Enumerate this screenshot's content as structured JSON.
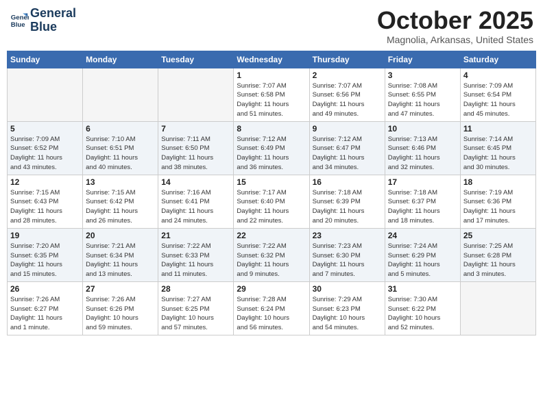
{
  "header": {
    "logo_line1": "General",
    "logo_line2": "Blue",
    "month": "October 2025",
    "location": "Magnolia, Arkansas, United States"
  },
  "weekdays": [
    "Sunday",
    "Monday",
    "Tuesday",
    "Wednesday",
    "Thursday",
    "Friday",
    "Saturday"
  ],
  "weeks": [
    [
      {
        "day": "",
        "info": ""
      },
      {
        "day": "",
        "info": ""
      },
      {
        "day": "",
        "info": ""
      },
      {
        "day": "1",
        "info": "Sunrise: 7:07 AM\nSunset: 6:58 PM\nDaylight: 11 hours\nand 51 minutes."
      },
      {
        "day": "2",
        "info": "Sunrise: 7:07 AM\nSunset: 6:56 PM\nDaylight: 11 hours\nand 49 minutes."
      },
      {
        "day": "3",
        "info": "Sunrise: 7:08 AM\nSunset: 6:55 PM\nDaylight: 11 hours\nand 47 minutes."
      },
      {
        "day": "4",
        "info": "Sunrise: 7:09 AM\nSunset: 6:54 PM\nDaylight: 11 hours\nand 45 minutes."
      }
    ],
    [
      {
        "day": "5",
        "info": "Sunrise: 7:09 AM\nSunset: 6:52 PM\nDaylight: 11 hours\nand 43 minutes."
      },
      {
        "day": "6",
        "info": "Sunrise: 7:10 AM\nSunset: 6:51 PM\nDaylight: 11 hours\nand 40 minutes."
      },
      {
        "day": "7",
        "info": "Sunrise: 7:11 AM\nSunset: 6:50 PM\nDaylight: 11 hours\nand 38 minutes."
      },
      {
        "day": "8",
        "info": "Sunrise: 7:12 AM\nSunset: 6:49 PM\nDaylight: 11 hours\nand 36 minutes."
      },
      {
        "day": "9",
        "info": "Sunrise: 7:12 AM\nSunset: 6:47 PM\nDaylight: 11 hours\nand 34 minutes."
      },
      {
        "day": "10",
        "info": "Sunrise: 7:13 AM\nSunset: 6:46 PM\nDaylight: 11 hours\nand 32 minutes."
      },
      {
        "day": "11",
        "info": "Sunrise: 7:14 AM\nSunset: 6:45 PM\nDaylight: 11 hours\nand 30 minutes."
      }
    ],
    [
      {
        "day": "12",
        "info": "Sunrise: 7:15 AM\nSunset: 6:43 PM\nDaylight: 11 hours\nand 28 minutes."
      },
      {
        "day": "13",
        "info": "Sunrise: 7:15 AM\nSunset: 6:42 PM\nDaylight: 11 hours\nand 26 minutes."
      },
      {
        "day": "14",
        "info": "Sunrise: 7:16 AM\nSunset: 6:41 PM\nDaylight: 11 hours\nand 24 minutes."
      },
      {
        "day": "15",
        "info": "Sunrise: 7:17 AM\nSunset: 6:40 PM\nDaylight: 11 hours\nand 22 minutes."
      },
      {
        "day": "16",
        "info": "Sunrise: 7:18 AM\nSunset: 6:39 PM\nDaylight: 11 hours\nand 20 minutes."
      },
      {
        "day": "17",
        "info": "Sunrise: 7:18 AM\nSunset: 6:37 PM\nDaylight: 11 hours\nand 18 minutes."
      },
      {
        "day": "18",
        "info": "Sunrise: 7:19 AM\nSunset: 6:36 PM\nDaylight: 11 hours\nand 17 minutes."
      }
    ],
    [
      {
        "day": "19",
        "info": "Sunrise: 7:20 AM\nSunset: 6:35 PM\nDaylight: 11 hours\nand 15 minutes."
      },
      {
        "day": "20",
        "info": "Sunrise: 7:21 AM\nSunset: 6:34 PM\nDaylight: 11 hours\nand 13 minutes."
      },
      {
        "day": "21",
        "info": "Sunrise: 7:22 AM\nSunset: 6:33 PM\nDaylight: 11 hours\nand 11 minutes."
      },
      {
        "day": "22",
        "info": "Sunrise: 7:22 AM\nSunset: 6:32 PM\nDaylight: 11 hours\nand 9 minutes."
      },
      {
        "day": "23",
        "info": "Sunrise: 7:23 AM\nSunset: 6:30 PM\nDaylight: 11 hours\nand 7 minutes."
      },
      {
        "day": "24",
        "info": "Sunrise: 7:24 AM\nSunset: 6:29 PM\nDaylight: 11 hours\nand 5 minutes."
      },
      {
        "day": "25",
        "info": "Sunrise: 7:25 AM\nSunset: 6:28 PM\nDaylight: 11 hours\nand 3 minutes."
      }
    ],
    [
      {
        "day": "26",
        "info": "Sunrise: 7:26 AM\nSunset: 6:27 PM\nDaylight: 11 hours\nand 1 minute."
      },
      {
        "day": "27",
        "info": "Sunrise: 7:26 AM\nSunset: 6:26 PM\nDaylight: 10 hours\nand 59 minutes."
      },
      {
        "day": "28",
        "info": "Sunrise: 7:27 AM\nSunset: 6:25 PM\nDaylight: 10 hours\nand 57 minutes."
      },
      {
        "day": "29",
        "info": "Sunrise: 7:28 AM\nSunset: 6:24 PM\nDaylight: 10 hours\nand 56 minutes."
      },
      {
        "day": "30",
        "info": "Sunrise: 7:29 AM\nSunset: 6:23 PM\nDaylight: 10 hours\nand 54 minutes."
      },
      {
        "day": "31",
        "info": "Sunrise: 7:30 AM\nSunset: 6:22 PM\nDaylight: 10 hours\nand 52 minutes."
      },
      {
        "day": "",
        "info": ""
      }
    ]
  ]
}
